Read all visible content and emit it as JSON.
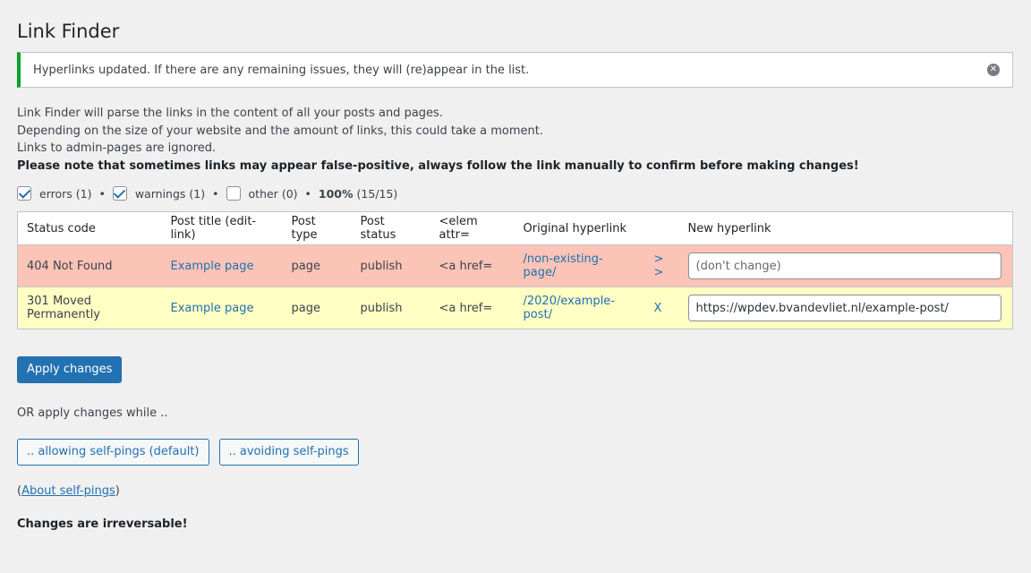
{
  "page": {
    "title": "Link Finder"
  },
  "notice": {
    "message": "Hyperlinks updated. If there are any remaining issues, they will (re)appear in the list.",
    "dismiss_glyph": "✕"
  },
  "intro": {
    "line1": "Link Finder will parse the links in the content of all your posts and pages.",
    "line2": "Depending on the size of your website and the amount of links, this could take a moment.",
    "line3": "Links to admin-pages are ignored.",
    "line4": "Please note that sometimes links may appear false-positive, always follow the link manually to confirm before making changes!"
  },
  "filters": {
    "errors": {
      "label": "errors",
      "count": "(1)",
      "checked": true
    },
    "warnings": {
      "label": "warnings",
      "count": "(1)",
      "checked": true
    },
    "other": {
      "label": "other",
      "count": "(0)",
      "checked": false
    },
    "separator": "•",
    "progress_pct": "100%",
    "progress_count": "(15/15)"
  },
  "table": {
    "headers": {
      "status": "Status code",
      "title": "Post title (edit-link)",
      "type": "Post type",
      "post_status": "Post status",
      "elem": "<elem attr=",
      "original": "Original hyperlink",
      "new": "New hyperlink"
    },
    "rows": [
      {
        "status": "404 Not Found",
        "title": "Example page",
        "type": "page",
        "post_status": "publish",
        "elem": "<a href=",
        "original": "/non-existing-page/",
        "action": "> >",
        "new_value": "",
        "new_placeholder": "(don't change)"
      },
      {
        "status": "301 Moved Permanently",
        "title": "Example page",
        "type": "page",
        "post_status": "publish",
        "elem": "<a href=",
        "original": "/2020/example-post/",
        "action": "X",
        "new_value": "https://wpdev.bvandevliet.nl/example-post/",
        "new_placeholder": ""
      }
    ]
  },
  "actions": {
    "apply": "Apply changes",
    "or_text": "OR apply changes while ..",
    "allow_pings": ".. allowing self-pings (default)",
    "avoid_pings": ".. avoiding self-pings",
    "about_open": "(",
    "about_link": "About self-pings",
    "about_close": ")",
    "warning": "Changes are irreversable!"
  },
  "colors": {
    "error_row": "#fbc4b7",
    "warning_row": "#ffffc4",
    "accent": "#2271b1",
    "notice_border": "#00a32a"
  }
}
